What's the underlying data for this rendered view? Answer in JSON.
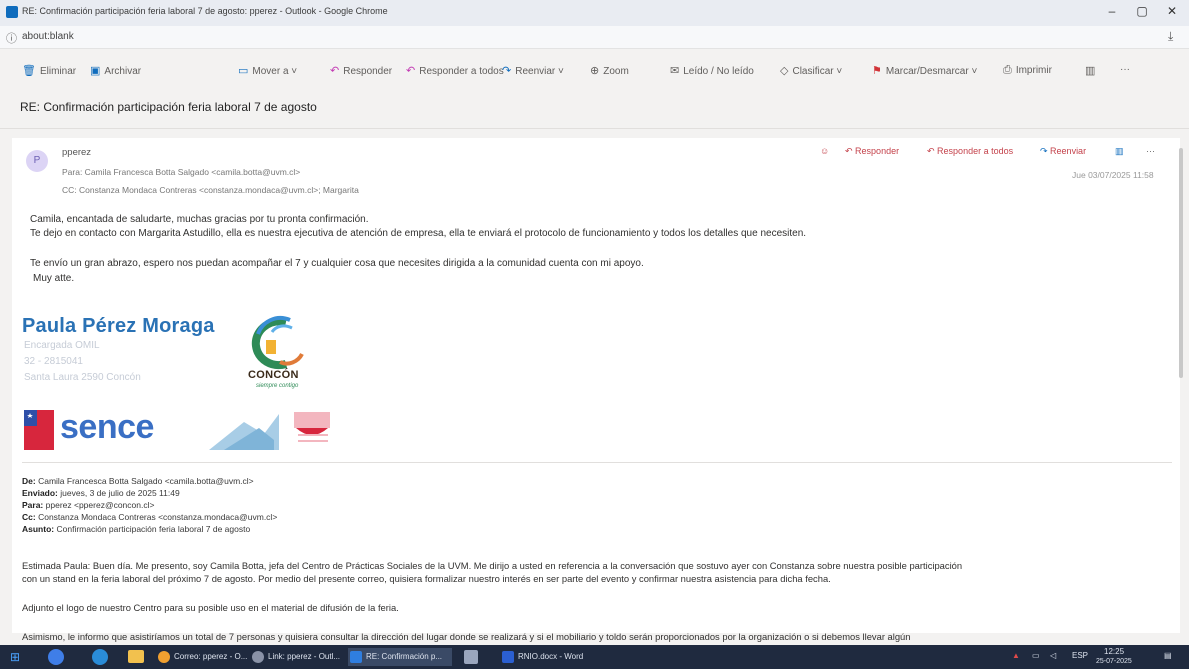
{
  "window": {
    "title": "RE: Confirmación participación feria laboral 7 de agosto: pperez - Outlook - Google Chrome",
    "controls": [
      "–",
      "▢",
      "✕"
    ]
  },
  "address": {
    "url": "about:blank"
  },
  "toolbar": {
    "eliminar": "Eliminar",
    "archivar": "Archivar",
    "mover": "Mover a",
    "responder": "Responder",
    "responder_todos": "Responder a todos",
    "reenviar": "Reenviar",
    "zoom": "Zoom",
    "leido": "Leído / No leído",
    "clasificar": "Clasificar",
    "marcar": "Marcar/Desmarcar",
    "imprimir": "Imprimir",
    "more": "···"
  },
  "subject": "RE: Confirmación participación feria laboral 7 de agosto",
  "message": {
    "avatar_initial": "P",
    "sender": "pperez",
    "to": "Para: Camila Francesca Botta Salgado <camila.botta@uvm.cl>",
    "cc": "CC: Constanza Mondaca Contreras <constanza.mondaca@uvm.cl>; Margarita",
    "date": "Jue 03/07/2025 11:58",
    "actions": {
      "responder": "Responder",
      "responder_todos": "Responder a todos",
      "reenviar": "Reenviar",
      "more": "···"
    },
    "body": [
      "Camila, encantada de saludarte, muchas gracias por tu pronta confirmación.",
      "Te dejo en contacto con Margarita Astudillo, ella es nuestra ejecutiva de atención de empresa, ella te enviará el protocolo de funcionamiento y todos los detalles que necesiten.",
      "Te envío un gran abrazo, espero nos puedan acompañar el 7 y cualquier cosa que necesites dirigida a la comunidad cuenta con mi apoyo.",
      "Muy atte."
    ],
    "signature": {
      "name": "Paula Pérez Moraga",
      "role": "Encargada OMIL",
      "phone": "32 - 2815041",
      "address": "Santa Laura 2590 Concón",
      "logo_concon": "CONCÓN",
      "logo_concon_tag": "siempre contigo",
      "logo_sence": "sence"
    }
  },
  "quoted": {
    "from_label": "De:",
    "from": "Camila Francesca Botta Salgado <camila.botta@uvm.cl>",
    "sent_label": "Enviado:",
    "sent": "jueves, 3 de julio de 2025 11:49",
    "to_label": "Para:",
    "to": "pperez <pperez@concon.cl>",
    "cc_label": "Cc:",
    "cc": "Constanza Mondaca Contreras <constanza.mondaca@uvm.cl>",
    "subject_label": "Asunto:",
    "subject": "Confirmación participación feria laboral 7 de agosto",
    "p1a": "Estimada Paula: Buen día. Me presento, soy Camila Botta, jefa del Centro de Prácticas Sociales de la UVM. Me dirijo a usted en referencia a la conversación que sostuvo ayer con Constanza sobre nuestra posible participación",
    "p1b": "con un stand en la feria laboral del próximo 7 de agosto. Por medio del presente correo, quisiera formalizar nuestro interés en ser parte del evento y confirmar nuestra asistencia para dicha fecha.",
    "p2": "Adjunto el logo de nuestro Centro para su posible uso en el material de difusión de la feria.",
    "p3": "Asimismo, le informo que asistiríamos un total de 7 personas y quisiera consultar la dirección del lugar donde se realizará y si el mobiliario y toldo serán proporcionados por la organización o si debemos llevar algún"
  },
  "taskbar": {
    "items": [
      "Correo: pperez - O...",
      "Link: pperez - Outl...",
      "RE: Confirmación p...",
      "RNIO.docx - Word"
    ],
    "lang": "ESP",
    "time": "12:25",
    "date": "25-07-2025"
  },
  "colors": {
    "accent": "#0f6cbd",
    "sig_blue": "#2a72b5",
    "sence_red": "#d7263d",
    "sence_blue": "#3a6fc4"
  }
}
